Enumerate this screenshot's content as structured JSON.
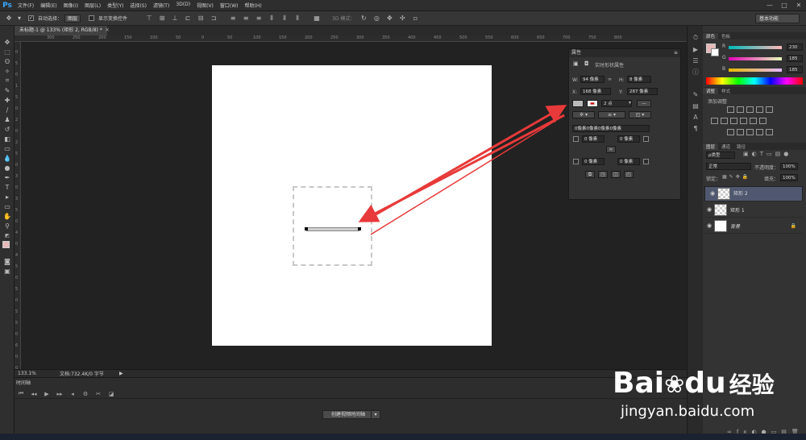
{
  "app": {
    "logo": "Ps",
    "menus": [
      "文件(F)",
      "编辑(E)",
      "图像(I)",
      "图层(L)",
      "类型(Y)",
      "选择(S)",
      "滤镜(T)",
      "3D(D)",
      "视图(V)",
      "窗口(W)",
      "帮助(H)"
    ],
    "window_buttons": [
      "—",
      "□",
      "✕"
    ]
  },
  "options": {
    "auto_select_label": "自动选择：",
    "auto_select_value": "图层",
    "show_transform_label": "显示变换控件",
    "mode3d_label": "3D 模式：",
    "workspace": "基本功能"
  },
  "document": {
    "tab_title": "未标题-1 @ 133% (矩形 2, RGB/8) *",
    "zoom": "133.1%",
    "doc_info": "文档:732.4K/0 字节"
  },
  "ruler": {
    "h": [
      "300",
      "250",
      "200",
      "150",
      "100",
      "50",
      "0",
      "50",
      "100",
      "150",
      "200",
      "250",
      "300",
      "350",
      "400",
      "450",
      "500",
      "550",
      "600",
      "650",
      "700",
      "750",
      "800"
    ],
    "v": [
      "0",
      "5",
      "0",
      "1",
      "5",
      "0",
      "2",
      "0",
      "2",
      "5",
      "0",
      "3",
      "0",
      "3",
      "5",
      "0",
      "4",
      "0",
      "4",
      "5",
      "0",
      "5",
      "0",
      "5",
      "5",
      "0",
      "6",
      "0",
      "0"
    ]
  },
  "timeline": {
    "tab": "时间轴",
    "create_button": "创建视频时间轴"
  },
  "properties": {
    "tab": "属性",
    "title": "实时形状属性",
    "w_label": "W:",
    "w_value": "94 像素",
    "h_label": "H:",
    "h_value": "8 像素",
    "x_label": "X:",
    "x_value": "168 像素",
    "y_label": "Y:",
    "y_value": "287 像素",
    "stroke_width": "2 点",
    "corner_all": "0像素0像素0像素0像素",
    "corner_tl": "0 像素",
    "corner_tr": "0 像素",
    "corner_bl": "0 像素",
    "corner_br": "0 像素"
  },
  "color_panel": {
    "tabs": [
      "颜色",
      "色板"
    ],
    "r_label": "R",
    "g_label": "G",
    "b_label": "B",
    "r_value": "230",
    "g_value": "185",
    "b_value": "185"
  },
  "adjust_panel": {
    "tabs": [
      "调整",
      "样式"
    ],
    "title": "添加调整"
  },
  "layers_panel": {
    "tabs": [
      "图层",
      "通道",
      "路径"
    ],
    "filter": "ρ类型",
    "blend_mode": "正常",
    "opacity_label": "不透明度：",
    "opacity_value": "100%",
    "lock_label": "锁定：",
    "fill_label": "填充：",
    "fill_value": "100%",
    "layers": [
      {
        "name": "矩形 2",
        "selected": true
      },
      {
        "name": "矩形 1",
        "selected": false
      },
      {
        "name": "背景",
        "selected": false
      }
    ]
  },
  "watermark": {
    "brand": "Bai",
    "paw": "du",
    "cn": "经验",
    "url": "jingyan.baidu.com"
  },
  "colors": {
    "arrow": "#e83a3a",
    "foreground": "#e6b9b9",
    "accent": "#37a8ff"
  }
}
